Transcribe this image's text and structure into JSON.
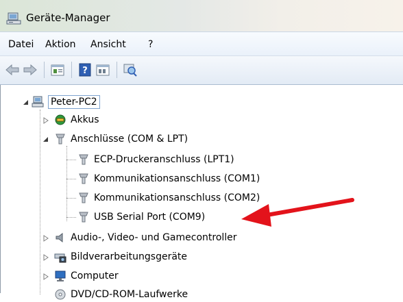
{
  "window": {
    "title": "Geräte-Manager"
  },
  "menu": [
    "Datei",
    "Aktion",
    "Ansicht",
    "?"
  ],
  "toolbar": {
    "buttons": [
      "back-arrow-icon",
      "forward-arrow-icon",
      "properties-icon",
      "help-icon",
      "details-icon",
      "scan-hardware-icon"
    ]
  },
  "tree": {
    "root": "Peter-PC2",
    "items": {
      "akkus": "Akkus",
      "anschluesse": "Anschlüsse (COM & LPT)",
      "ecp": "ECP-Druckeranschluss (LPT1)",
      "com1": "Kommunikationsanschluss (COM1)",
      "com2": "Kommunikationsanschluss (COM2)",
      "usb": "USB Serial Port (COM9)",
      "audio": "Audio-, Video- und Gamecontroller",
      "bild": "Bildverarbeitungsgeräte",
      "computer": "Computer",
      "dvd": "DVD/CD-ROM-Laufwerke"
    }
  },
  "colors": {
    "annotation_arrow": "#e3131b"
  }
}
